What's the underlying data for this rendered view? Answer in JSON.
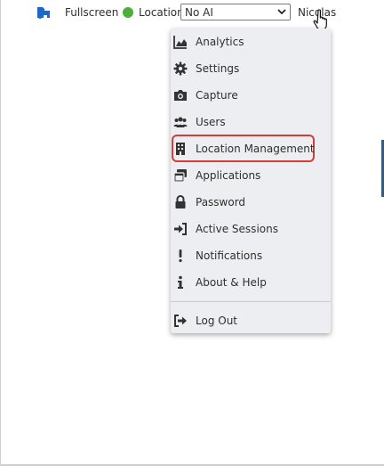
{
  "topbar": {
    "fullscreen_label": "Fullscreen",
    "location_label": "Location:",
    "location_value": "No AI",
    "user_name": "Nicolas"
  },
  "menu": {
    "items": [
      {
        "label": "Analytics",
        "icon": "chart-area-icon"
      },
      {
        "label": "Settings",
        "icon": "gear-icon"
      },
      {
        "label": "Capture",
        "icon": "camera-icon"
      },
      {
        "label": "Users",
        "icon": "users-icon"
      },
      {
        "label": "Location Management",
        "icon": "building-icon",
        "highlighted": true
      },
      {
        "label": "Applications",
        "icon": "window-restore-icon"
      },
      {
        "label": "Password",
        "icon": "lock-icon"
      },
      {
        "label": "Active Sessions",
        "icon": "sign-in-icon"
      },
      {
        "label": "Notifications",
        "icon": "exclamation-icon"
      },
      {
        "label": "About & Help",
        "icon": "info-icon"
      }
    ],
    "logout": {
      "label": "Log Out",
      "icon": "sign-out-icon"
    }
  },
  "colors": {
    "status_online": "#4caf3a",
    "highlight_border": "#d93a3a",
    "fullscreen_icon": "#1e66c8",
    "menu_background": "#eceef1"
  }
}
